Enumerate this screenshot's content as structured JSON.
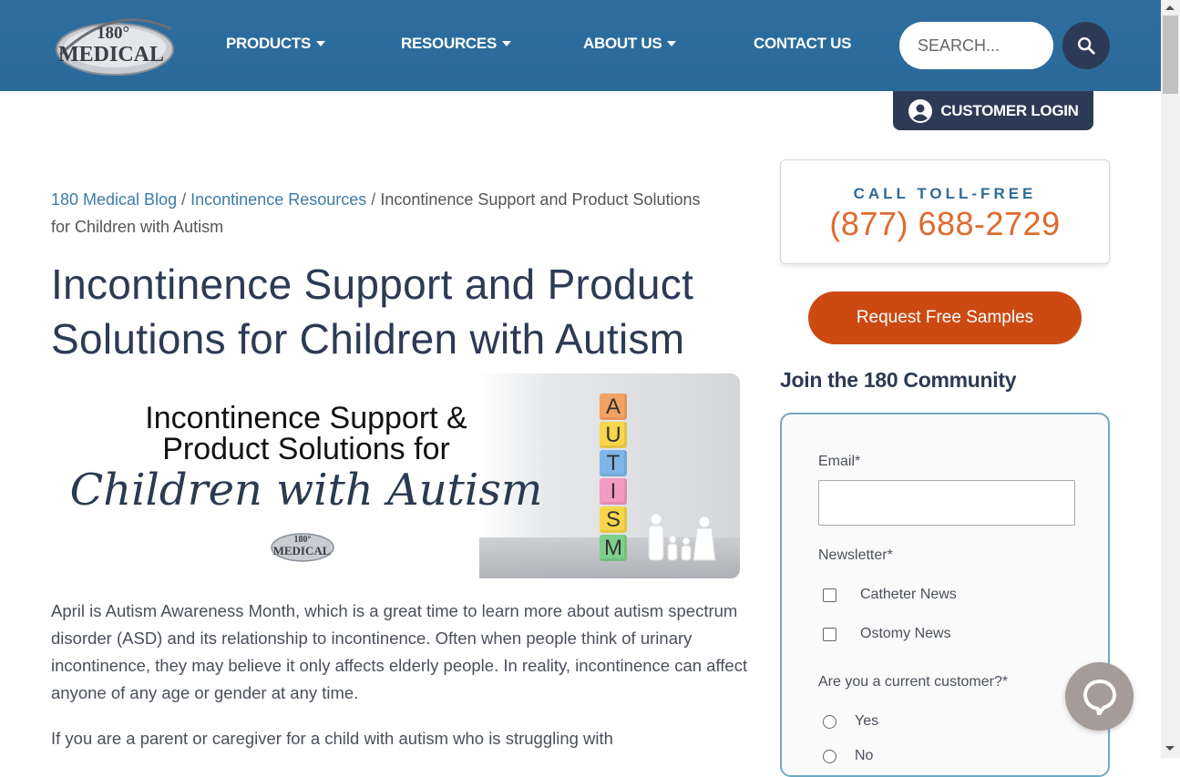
{
  "header": {
    "logo": {
      "top": "180°",
      "bottom": "MEDICAL"
    },
    "nav": [
      {
        "label": "PRODUCTS",
        "dropdown": true
      },
      {
        "label": "RESOURCES",
        "dropdown": true
      },
      {
        "label": "ABOUT US",
        "dropdown": true
      },
      {
        "label": "CONTACT US",
        "dropdown": false
      }
    ],
    "search_placeholder": "SEARCH...",
    "search_icon": "search-icon",
    "login_label": "CUSTOMER LOGIN",
    "login_icon": "user-circle-icon"
  },
  "breadcrumb": {
    "items": [
      "180 Medical Blog",
      "Incontinence Resources"
    ],
    "separator": "/",
    "current": "Incontinence Support and Product Solutions for Children with Autism"
  },
  "article": {
    "title": "Incontinence Support and Product Solutions for Children with Autism",
    "hero": {
      "line1": "Incontinence Support &",
      "line2": "Product Solutions for",
      "line3": "Children with Autism",
      "logo_top": "180°",
      "logo_bottom": "MEDICAL",
      "blocks": [
        "A",
        "U",
        "T",
        "I",
        "S",
        "M"
      ],
      "block_colors": [
        "#f4a261",
        "#f7d64b",
        "#7fb6e8",
        "#f49ac1",
        "#f7d64b",
        "#7dd08c"
      ]
    },
    "paragraphs": [
      "April is Autism Awareness Month, which is a great time to learn more about autism spectrum disorder (ASD) and its relationship to incontinence. Often when people think of urinary incontinence, they may believe it only affects elderly people. In reality, incontinence can affect anyone of any age or gender at any time.",
      "If you are a parent or caregiver for a child with autism who is struggling with"
    ]
  },
  "sidebar": {
    "call_label": "CALL TOLL-FREE",
    "phone": "(877) 688-2729",
    "samples_button": "Request Free Samples",
    "community_title": "Join the 180 Community",
    "form": {
      "email_label": "Email*",
      "newsletter_label": "Newsletter*",
      "newsletter_options": [
        "Catheter News",
        "Ostomy News"
      ],
      "customer_label": "Are you a current customer?*",
      "customer_options": [
        "Yes",
        "No"
      ]
    }
  },
  "chat": {
    "icon": "chat-bubble-icon"
  },
  "colors": {
    "header_bg": "#2e6d9d",
    "navy": "#2d3a55",
    "orange_button": "#cc4a12",
    "phone_orange": "#e06a2e",
    "link_blue": "#3c7ba8"
  }
}
